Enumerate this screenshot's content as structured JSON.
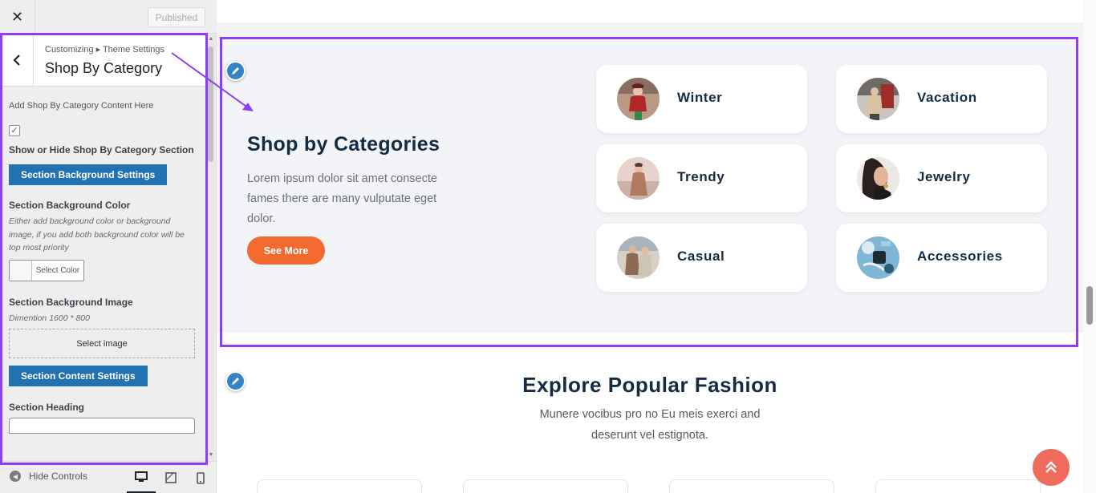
{
  "topbar": {
    "close_glyph": "✕",
    "publish_label": "Published"
  },
  "panel": {
    "breadcrumb": "Customizing ▸ Theme Settings",
    "title": "Shop By Category",
    "description": "Add Shop By Category Content Here",
    "show_hide_label": "Show or Hide Shop By Category Section",
    "show_hide_checked": true,
    "bg_settings_button": "Section Background Settings",
    "bg_color_title": "Section Background Color",
    "bg_color_desc": "Either add background color or background image, if you add both background color will be top most priority",
    "select_color_label": "Select Color",
    "bg_image_title": "Section Background Image",
    "bg_image_desc": "Dimention 1600 * 800",
    "select_image_label": "Select image",
    "content_settings_button": "Section Content Settings",
    "heading_title": "Section Heading"
  },
  "footer": {
    "hide_controls_label": "Hide Controls",
    "active_device": "desktop"
  },
  "preview": {
    "shop_title": "Shop by Categories",
    "shop_text": "Lorem ipsum dolor sit amet consecte fames there are many vulputate eget dolor.",
    "see_more_label": "See More",
    "categories": [
      {
        "label": "Winter"
      },
      {
        "label": "Vacation"
      },
      {
        "label": "Trendy"
      },
      {
        "label": "Jewelry"
      },
      {
        "label": "Casual"
      },
      {
        "label": "Accessories"
      }
    ],
    "explore_title": "Explore Popular Fashion",
    "explore_sub": "Munere vocibus pro no Eu meis exerci and deserunt vel estignota."
  },
  "colors": {
    "accent_blue": "#2271b1",
    "button_orange": "#f26a2e",
    "heading_navy": "#142c43",
    "highlight_purple": "#8e3ff5",
    "scroll_top_coral": "#ef6b5c"
  }
}
